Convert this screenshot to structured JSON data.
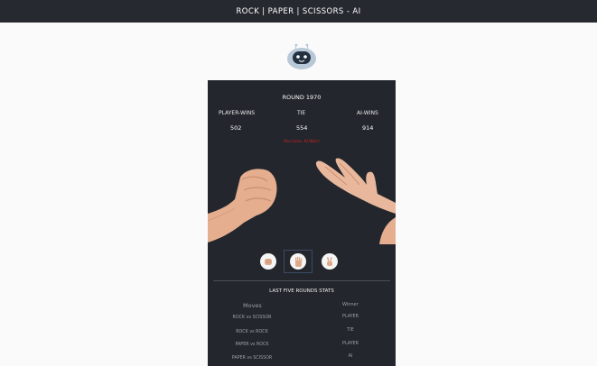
{
  "header": {
    "title": "ROCK | PAPER | SCISSORS - AI"
  },
  "game": {
    "round_label": "ROUND 1970",
    "score_labels": {
      "player": "PLAYER-WINS",
      "tie": "TIE",
      "ai": "AI-WINS"
    },
    "scores": {
      "player": "502",
      "tie": "554",
      "ai": "914"
    },
    "status_text": "You Lose. AI Won!"
  },
  "choices": [
    {
      "name": "rock",
      "icon": "fist-icon"
    },
    {
      "name": "paper",
      "icon": "open-hand-icon",
      "selected": true
    },
    {
      "name": "scissors",
      "icon": "victory-hand-icon"
    }
  ],
  "stats": {
    "title": "LAST FIVE ROUNDS STATS",
    "moves_header": "Moves",
    "winner_header": "Winner",
    "rows": [
      {
        "moves": "ROCK vs SCISSOR",
        "winner": "PLAYER"
      },
      {
        "moves": "ROCK vs ROCK",
        "winner": "TIE"
      },
      {
        "moves": "PAPER vs ROCK",
        "winner": "PLAYER"
      },
      {
        "moves": "PAPER vs SCISSOR",
        "winner": "AI"
      }
    ]
  },
  "colors": {
    "topbar": "#262a30",
    "panel": "#23262c",
    "status": "#d32323",
    "robot_face": "#b8c8d6",
    "robot_screen": "#23303f"
  }
}
